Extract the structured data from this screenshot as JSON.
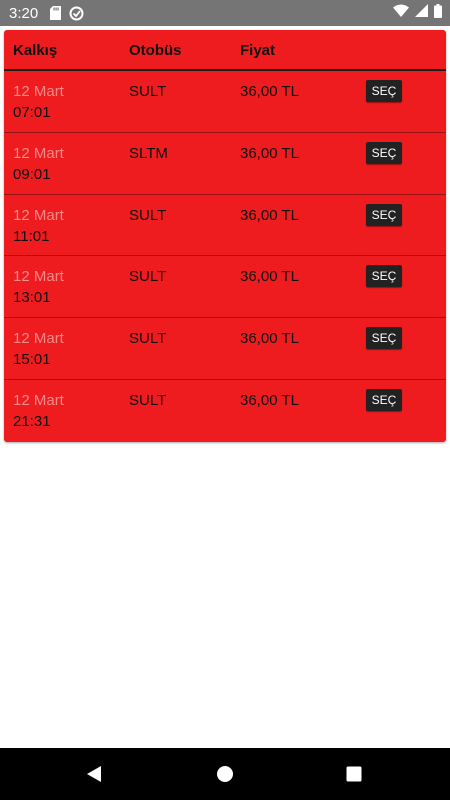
{
  "status_bar": {
    "time": "3:20",
    "left_icons": [
      "sd-card-icon",
      "data-saver-icon"
    ],
    "right_icons": [
      "wifi-icon",
      "signal-icon",
      "battery-icon"
    ]
  },
  "table": {
    "headers": {
      "departure": "Kalkış",
      "bus": "Otobüs",
      "price": "Fiyat"
    },
    "rows": [
      {
        "date": "12 Mart",
        "time": "07:01",
        "bus": "SULT",
        "price": "36,00 TL",
        "action": "SEÇ"
      },
      {
        "date": "12 Mart",
        "time": "09:01",
        "bus": "SLTM",
        "price": "36,00 TL",
        "action": "SEÇ"
      },
      {
        "date": "12 Mart",
        "time": "11:01",
        "bus": "SULT",
        "price": "36,00 TL",
        "action": "SEÇ"
      },
      {
        "date": "12 Mart",
        "time": "13:01",
        "bus": "SULT",
        "price": "36,00 TL",
        "action": "SEÇ"
      },
      {
        "date": "12 Mart",
        "time": "15:01",
        "bus": "SULT",
        "price": "36,00 TL",
        "action": "SEÇ"
      },
      {
        "date": "12 Mart",
        "time": "21:31",
        "bus": "SULT",
        "price": "36,00 TL",
        "action": "SEÇ"
      }
    ]
  },
  "nav_bar": {
    "buttons": [
      "back-icon",
      "home-icon",
      "recents-icon"
    ]
  },
  "colors": {
    "card_background": "#ee1c1f",
    "date_text": "#f58a8a",
    "button_background": "#222222",
    "status_bar": "#757575",
    "nav_bar": "#000000"
  }
}
